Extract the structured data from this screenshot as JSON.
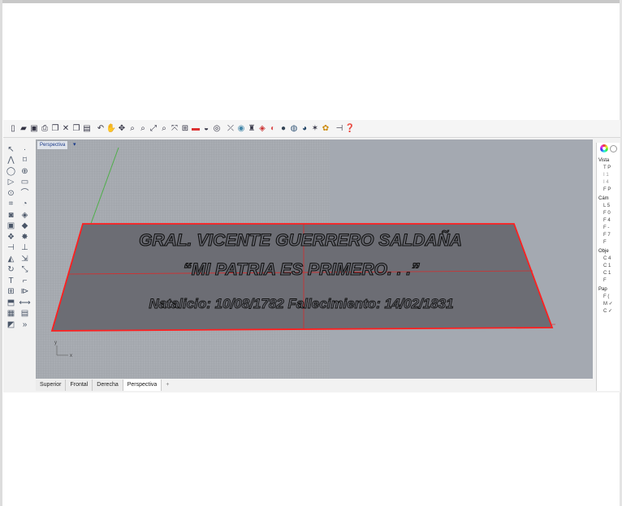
{
  "toolbar": {
    "icons": [
      "new-file-icon",
      "open-folder-icon",
      "save-icon",
      "print-icon",
      "copy-icon",
      "cut-icon",
      "copy-icon",
      "paste-icon",
      "undo-icon",
      "pan-hand-icon",
      "rotate-icon",
      "zoom-window-icon",
      "zoom-extents-icon",
      "zoom-selected-icon",
      "zoom-icon",
      "zoom-extents-all-icon",
      "four-viewports-icon",
      "layer-icon",
      "named-views-icon",
      "cplane-icon",
      "snapshot-icon",
      "properties-icon",
      "lock-icon",
      "material-icon",
      "render-color-icon",
      "render-sphere-icon",
      "render-icon",
      "render-preview-icon",
      "light-icon",
      "options-gear-icon",
      "analysis-icon",
      "help-icon"
    ]
  },
  "viewport": {
    "label": "Perspectiva",
    "arrow": "▾"
  },
  "plaque": {
    "line1": "GRAL. VICENTE GUERRERO SALDAÑA",
    "line2": "“MI PATRIA ES PRIMERO. . .”",
    "line3": "Natalicio: 10/08/1782   Fallecimiento: 14/02/1831"
  },
  "axis": {
    "y": "y",
    "x": "x"
  },
  "tabs": [
    {
      "label": "Superior",
      "active": false
    },
    {
      "label": "Frontal",
      "active": false
    },
    {
      "label": "Derecha",
      "active": false
    },
    {
      "label": "Perspectiva",
      "active": true
    }
  ],
  "tab_add": "+",
  "right_panel": {
    "sections": [
      {
        "title": "Vista",
        "items": [
          "T P",
          "I 1",
          "I 4",
          "F P"
        ],
        "dim": [
          false,
          true,
          true,
          false
        ]
      },
      {
        "title": "Cám",
        "items": [
          "L 5",
          "F 0",
          "F 4",
          "F -",
          "F 7",
          "F"
        ],
        "dim": [
          false,
          false,
          false,
          false,
          false,
          false
        ]
      },
      {
        "title": "Obje",
        "items": [
          "C 4",
          "C 1",
          "C 1",
          "F"
        ],
        "dim": [
          false,
          false,
          false,
          false
        ]
      },
      {
        "title": "Pap",
        "items": [
          "F (",
          "M ✓",
          "C ✓"
        ],
        "dim": [
          false,
          false,
          false
        ]
      }
    ]
  }
}
